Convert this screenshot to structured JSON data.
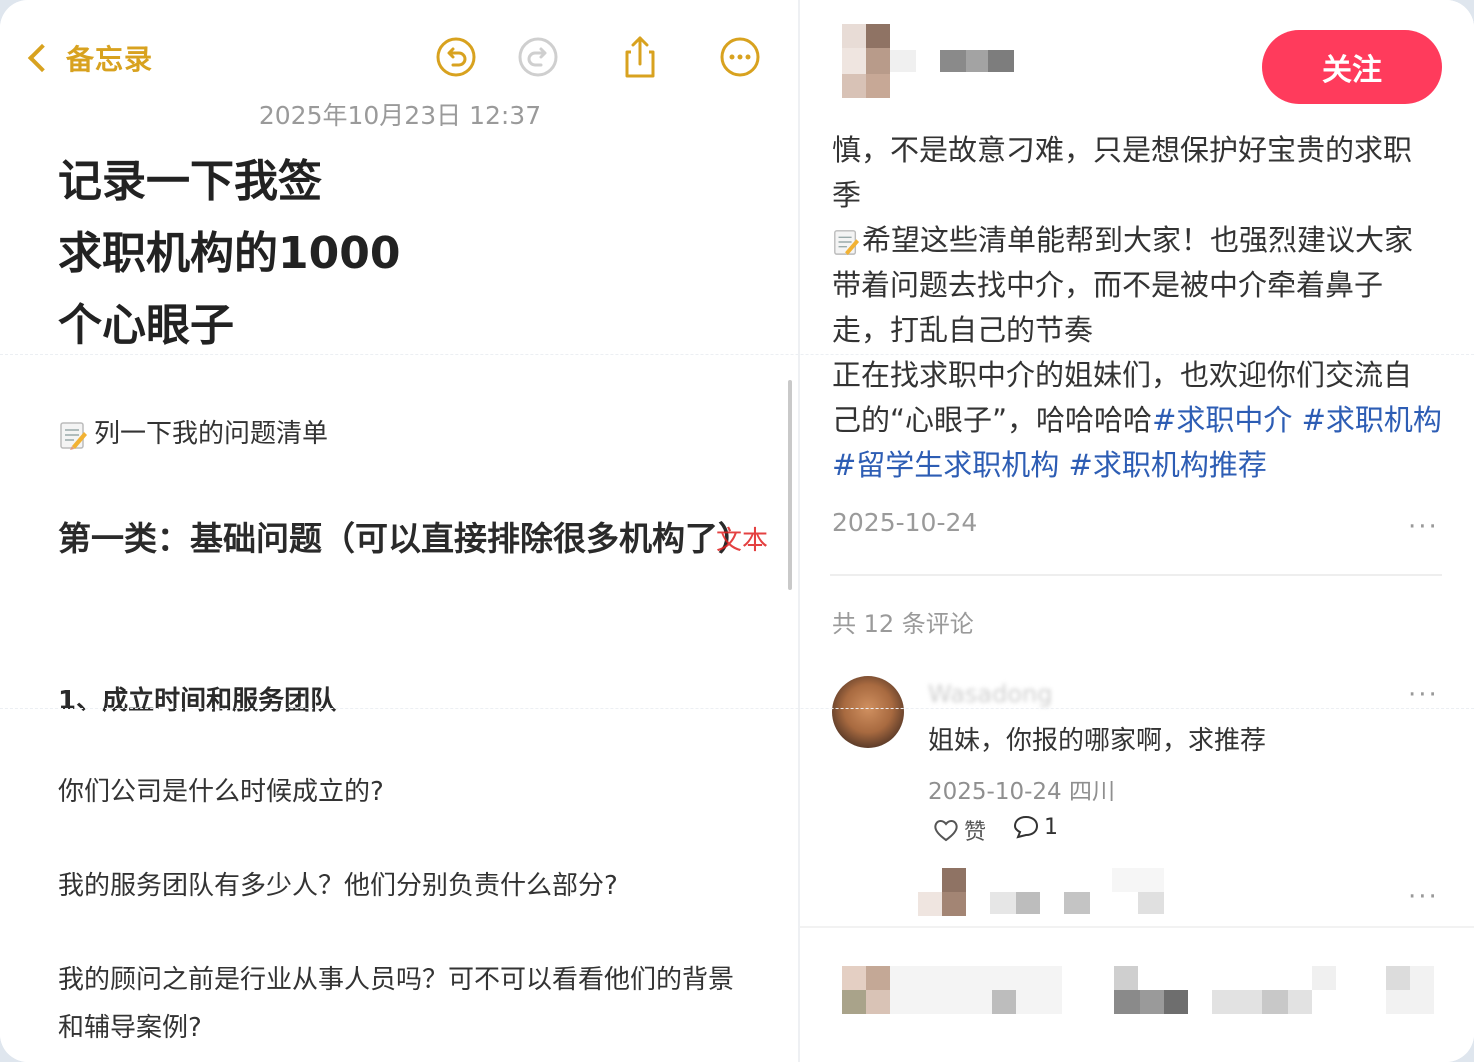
{
  "notes": {
    "back_label": "备忘录",
    "date": "2025年10月23日 12:37",
    "title_lines": [
      "记录一下我签",
      "求职机构的1000",
      "个心眼子"
    ],
    "list_intro": "列一下我的问题清单",
    "category_heading": "第一类：基础问题（可以直接排除很多机构了）",
    "section_heading": "1、成立时间和服务团队",
    "questions": [
      "你们公司是什么时候成立的?",
      "我的服务团队有多少人？他们分别负责什么部分?",
      "我的顾问之前是行业从事人员吗？可不可以看看他们的背景和辅导案例?"
    ],
    "watermark": "文本",
    "toolbar_icons": [
      "undo-icon",
      "redo-icon",
      "share-icon",
      "more-icon"
    ],
    "accent_color": "#d8a21f"
  },
  "post": {
    "follow_label": "关注",
    "body_lines": [
      "慎，不是故意刁难，只是想保护好宝贵的求职",
      "季",
      "希望这些清单能帮到大家！也强烈建议大家",
      "带着问题去找中介，而不是被中介牵着鼻子",
      "走，打乱自己的节奏",
      "正在找求职中介的姐妹们，也欢迎你们交流自",
      "己的“心眼子”，哈哈哈哈"
    ],
    "tags": [
      "#求职中介",
      "#求职机构",
      "#留学生求职机构",
      "#求职机构推荐"
    ],
    "date": "2025-10-24",
    "more": "···",
    "comment_count": "共 12 条评论",
    "comment": {
      "user": "Wasadong",
      "text": "姐妹，你报的哪家啊，求推荐",
      "meta": "2025-10-24 四川",
      "like_label": "赞",
      "reply_count": "1"
    },
    "follow_color": "#ff3b5c",
    "tag_color": "#2d5db4"
  }
}
